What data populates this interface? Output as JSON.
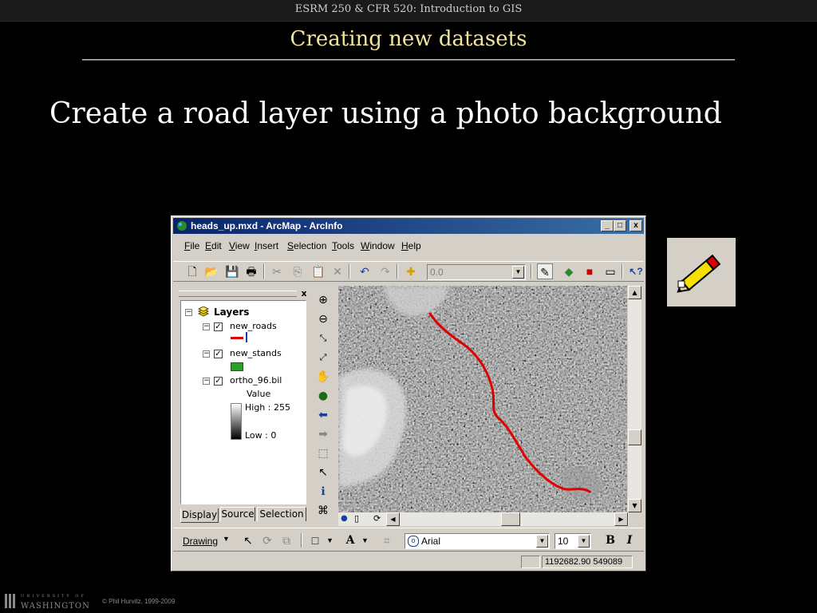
{
  "slide": {
    "course_title": "ESRM 250 & CFR 520: Introduction to GIS",
    "title": "Creating new datasets",
    "heading": "Create a road layer using a photo background"
  },
  "window": {
    "title": "heads_up.mxd - ArcMap - ArcInfo",
    "controls": [
      "_",
      "□",
      "x"
    ]
  },
  "menubar": [
    "File",
    "Edit",
    "View",
    "Insert",
    "Selection",
    "Tools",
    "Window",
    "Help"
  ],
  "standard_toolbar": {
    "scale_value": "0.0"
  },
  "toc": {
    "close": "x",
    "root": "Layers",
    "layers": [
      {
        "name": "new_roads",
        "checked": "✓",
        "expander": "−"
      },
      {
        "name": "new_stands",
        "checked": "✓",
        "expander": "−"
      },
      {
        "name": "ortho_96.bil",
        "checked": "✓",
        "expander": "−"
      }
    ],
    "raster_legend": {
      "field": "Value",
      "high": "High : 255",
      "low": "Low : 0"
    },
    "tabs": [
      "Display",
      "Source",
      "Selection"
    ]
  },
  "drawing_toolbar": {
    "drawing_label": "Drawing",
    "font_name": "Arial",
    "font_size": "10",
    "bold": "B",
    "italic": "I",
    "text_tool": "A"
  },
  "status": {
    "coordinates": "1192682.90  549089"
  },
  "footer": {
    "university_top": "UNIVERSITY OF",
    "university": "WASHINGTON",
    "copyright": "© Phil Hurvitz, 1999-2009"
  },
  "colors": {
    "slide_title": "#f2e69a",
    "road": "#e00000",
    "stands": "#2aa02a",
    "titlebar": "#0a246a"
  }
}
